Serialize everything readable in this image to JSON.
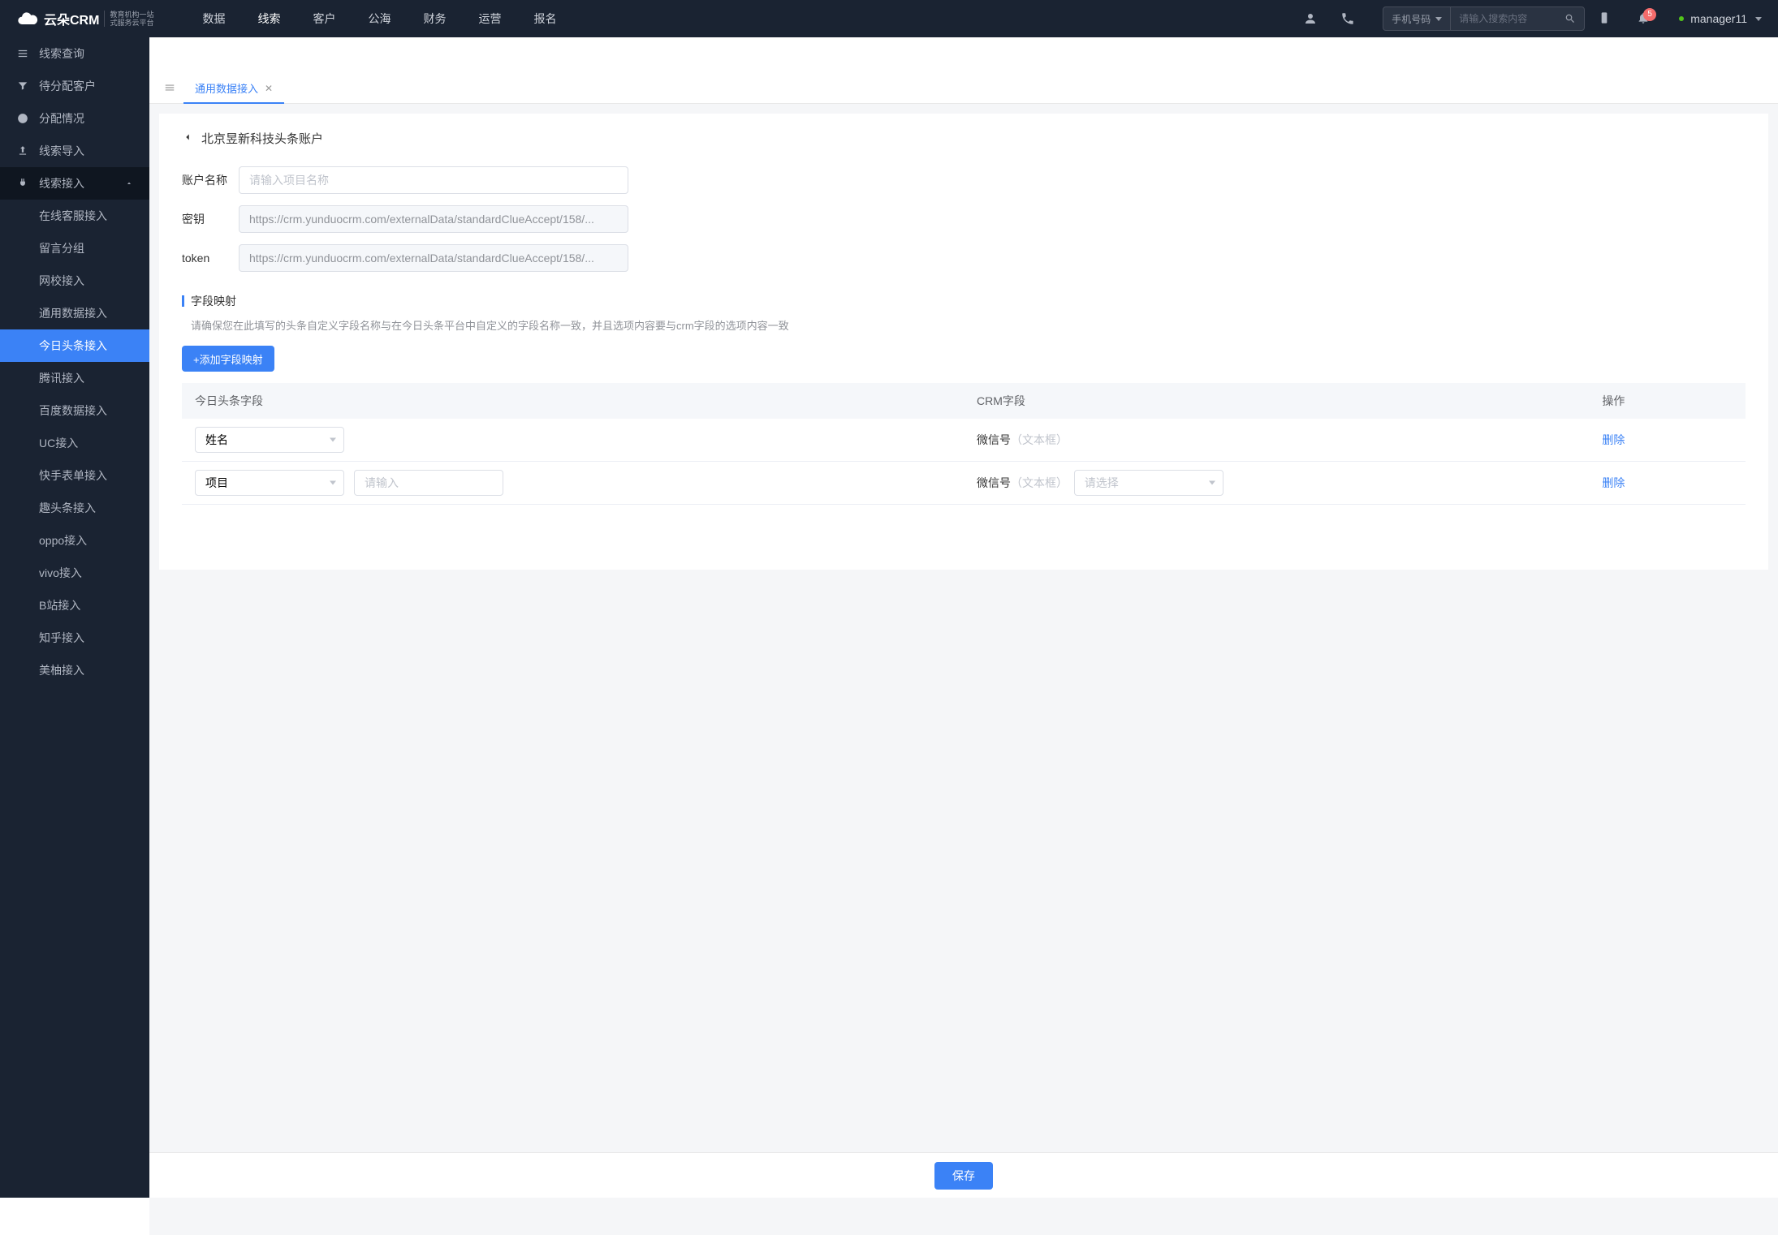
{
  "header": {
    "logo_main": "云朵CRM",
    "logo_sub1": "教育机构一站",
    "logo_sub2": "式服务云平台",
    "nav": [
      "数据",
      "线索",
      "客户",
      "公海",
      "财务",
      "运营",
      "报名"
    ],
    "nav_active_index": 1,
    "search_type": "手机号码",
    "search_placeholder": "请输入搜索内容",
    "badge_count": "5",
    "user_name": "manager11"
  },
  "sidebar": {
    "items": [
      {
        "label": "线索查询",
        "icon": "list"
      },
      {
        "label": "待分配客户",
        "icon": "filter"
      },
      {
        "label": "分配情况",
        "icon": "clock"
      },
      {
        "label": "线索导入",
        "icon": "export"
      },
      {
        "label": "线索接入",
        "icon": "plug",
        "open": true,
        "children": [
          {
            "label": "在线客服接入"
          },
          {
            "label": "留言分组"
          },
          {
            "label": "网校接入"
          },
          {
            "label": "通用数据接入"
          },
          {
            "label": "今日头条接入",
            "active": true
          },
          {
            "label": "腾讯接入"
          },
          {
            "label": "百度数据接入"
          },
          {
            "label": "UC接入"
          },
          {
            "label": "快手表单接入"
          },
          {
            "label": "趣头条接入"
          },
          {
            "label": "oppo接入"
          },
          {
            "label": "vivo接入"
          },
          {
            "label": "B站接入"
          },
          {
            "label": "知乎接入"
          },
          {
            "label": "美柚接入"
          }
        ]
      }
    ]
  },
  "tabs": {
    "items": [
      {
        "label": "通用数据接入",
        "active": true
      }
    ]
  },
  "page": {
    "title": "北京昱新科技头条账户",
    "form": {
      "account_label": "账户名称",
      "account_placeholder": "请输入项目名称",
      "account_value": "",
      "secret_label": "密钥",
      "secret_value": "https://crm.yunduocrm.com/externalData/standardClueAccept/158/...",
      "token_label": "token",
      "token_value": "https://crm.yunduocrm.com/externalData/standardClueAccept/158/..."
    },
    "mapping": {
      "title": "字段映射",
      "desc": "请确保您在此填写的头条自定义字段名称与在今日头条平台中自定义的字段名称一致，并且选项内容要与crm字段的选项内容一致",
      "add_btn": "+添加字段映射",
      "columns": {
        "c1": "今日头条字段",
        "c2": "CRM字段",
        "c3": "操作"
      },
      "rows": [
        {
          "field_select": "姓名",
          "crm_label": "微信号",
          "crm_hint": "（文本框）",
          "delete": "删除"
        },
        {
          "field_select": "项目",
          "input_placeholder": "请输入",
          "crm_label": "微信号",
          "crm_hint": "（文本框）",
          "crm_select_placeholder": "请选择",
          "delete": "删除"
        }
      ]
    },
    "save_btn": "保存"
  }
}
